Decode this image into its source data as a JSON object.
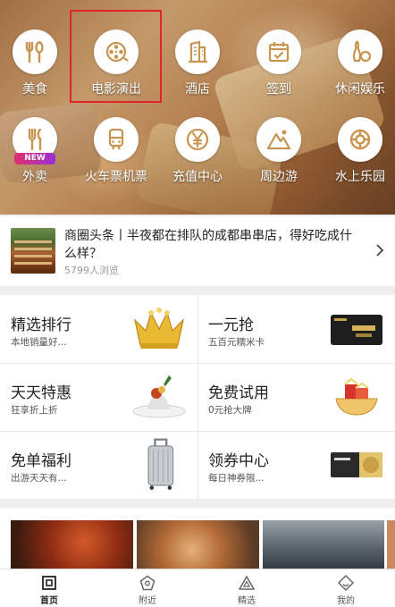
{
  "categories": [
    {
      "label": "美食",
      "icon": "food-icon"
    },
    {
      "label": "电影演出",
      "icon": "film-reel-icon"
    },
    {
      "label": "酒店",
      "icon": "hotel-icon"
    },
    {
      "label": "签到",
      "icon": "checkin-icon"
    },
    {
      "label": "休闲娱乐",
      "icon": "bowling-icon"
    },
    {
      "label": "外卖",
      "icon": "takeout-icon",
      "badge": "NEW"
    },
    {
      "label": "火车票机票",
      "icon": "train-icon"
    },
    {
      "label": "充值中心",
      "icon": "yuan-icon"
    },
    {
      "label": "周边游",
      "icon": "mountain-icon"
    },
    {
      "label": "水上乐园",
      "icon": "lifebuoy-icon"
    }
  ],
  "headline": {
    "title": "商圈头条丨半夜都在排队的成都串串店，得好吃成什么样？",
    "views": "5799人浏览"
  },
  "promos": [
    {
      "title": "精选排行",
      "subtitle": "本地销量好...",
      "image": "crown"
    },
    {
      "title": "一元抢",
      "subtitle": "五百元糯米卡",
      "image": "gift-card"
    },
    {
      "title": "天天特惠",
      "subtitle": "狂享折上折",
      "image": "dessert-plate"
    },
    {
      "title": "免费试用",
      "subtitle": "0元抢大牌",
      "image": "gift-bowl"
    },
    {
      "title": "免单福利",
      "subtitle": "出游天天有...",
      "image": "suitcase"
    },
    {
      "title": "领券中心",
      "subtitle": "每日神券限...",
      "image": "coupon"
    }
  ],
  "tabs": [
    {
      "label": "首页",
      "icon": "home-icon",
      "active": true
    },
    {
      "label": "附近",
      "icon": "nearby-icon",
      "active": false
    },
    {
      "label": "精选",
      "icon": "featured-icon",
      "active": false
    },
    {
      "label": "我的",
      "icon": "profile-icon",
      "active": false
    }
  ],
  "colors": {
    "accent": "#c8944f",
    "highlight_border": "#e0242a",
    "new_badge": "#e0306c"
  }
}
